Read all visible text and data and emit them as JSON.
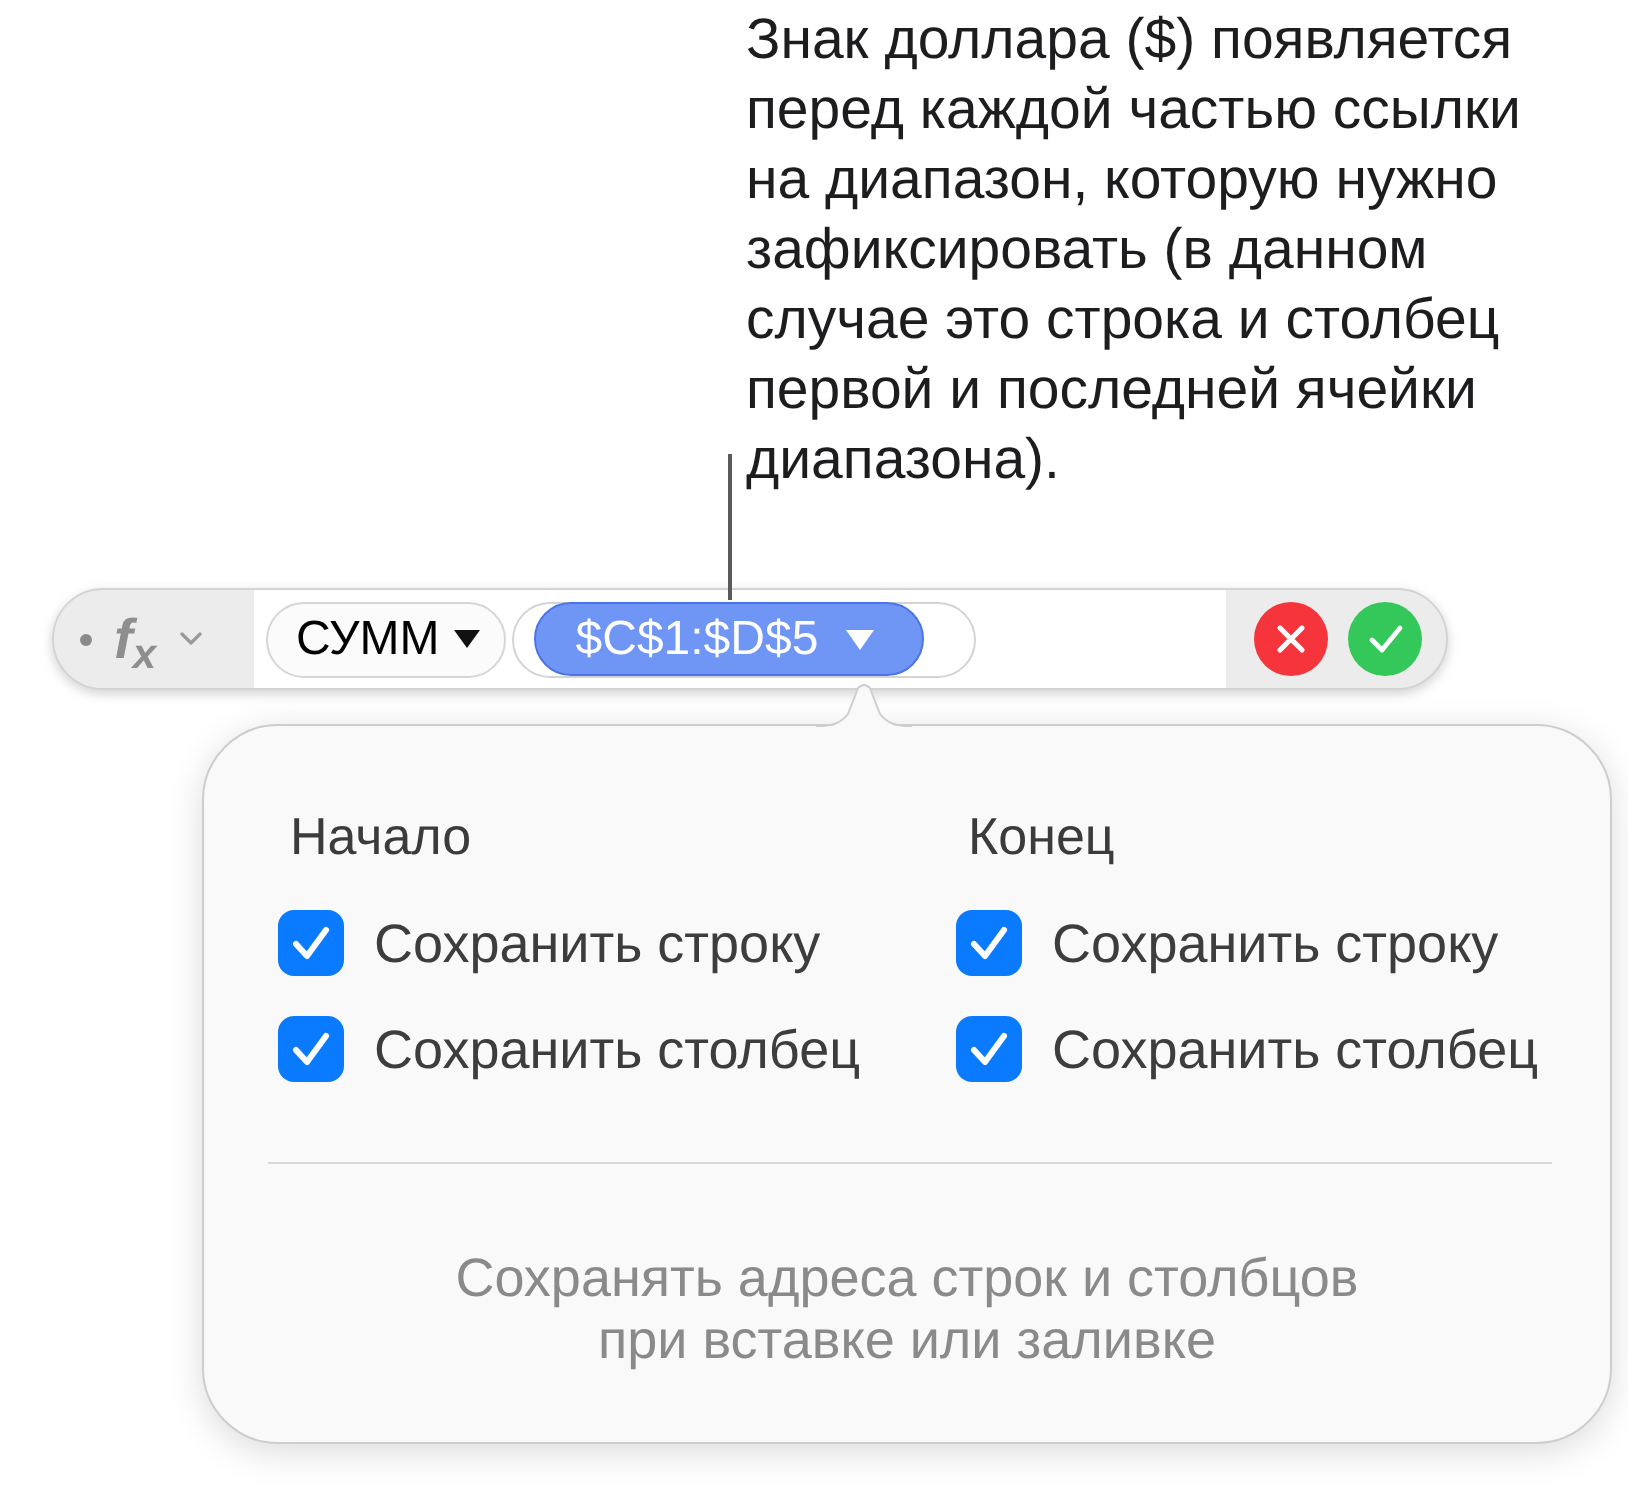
{
  "callout": {
    "text": "Знак доллара ($) появляется перед каждой частью ссылки на диапазон, которую нужно зафиксировать (в данном случае это строка и столбец первой и последней ячейки диапазона)."
  },
  "formula_bar": {
    "formula_label": "f$_{x}$",
    "function_token": {
      "label": "СУММ"
    },
    "range_token": {
      "label": "$C$1:$D$5",
      "selected": true
    }
  },
  "popover": {
    "columns": [
      {
        "heading": "Начало",
        "options": [
          {
            "label": "Сохранить строку",
            "checked": true
          },
          {
            "label": "Сохранить столбец",
            "checked": true
          }
        ]
      },
      {
        "heading": "Конец",
        "options": [
          {
            "label": "Сохранить строку",
            "checked": true
          },
          {
            "label": "Сохранить столбец",
            "checked": true
          }
        ]
      }
    ],
    "footer": "Сохранять адреса строк и столбцов при вставке или заливке"
  }
}
